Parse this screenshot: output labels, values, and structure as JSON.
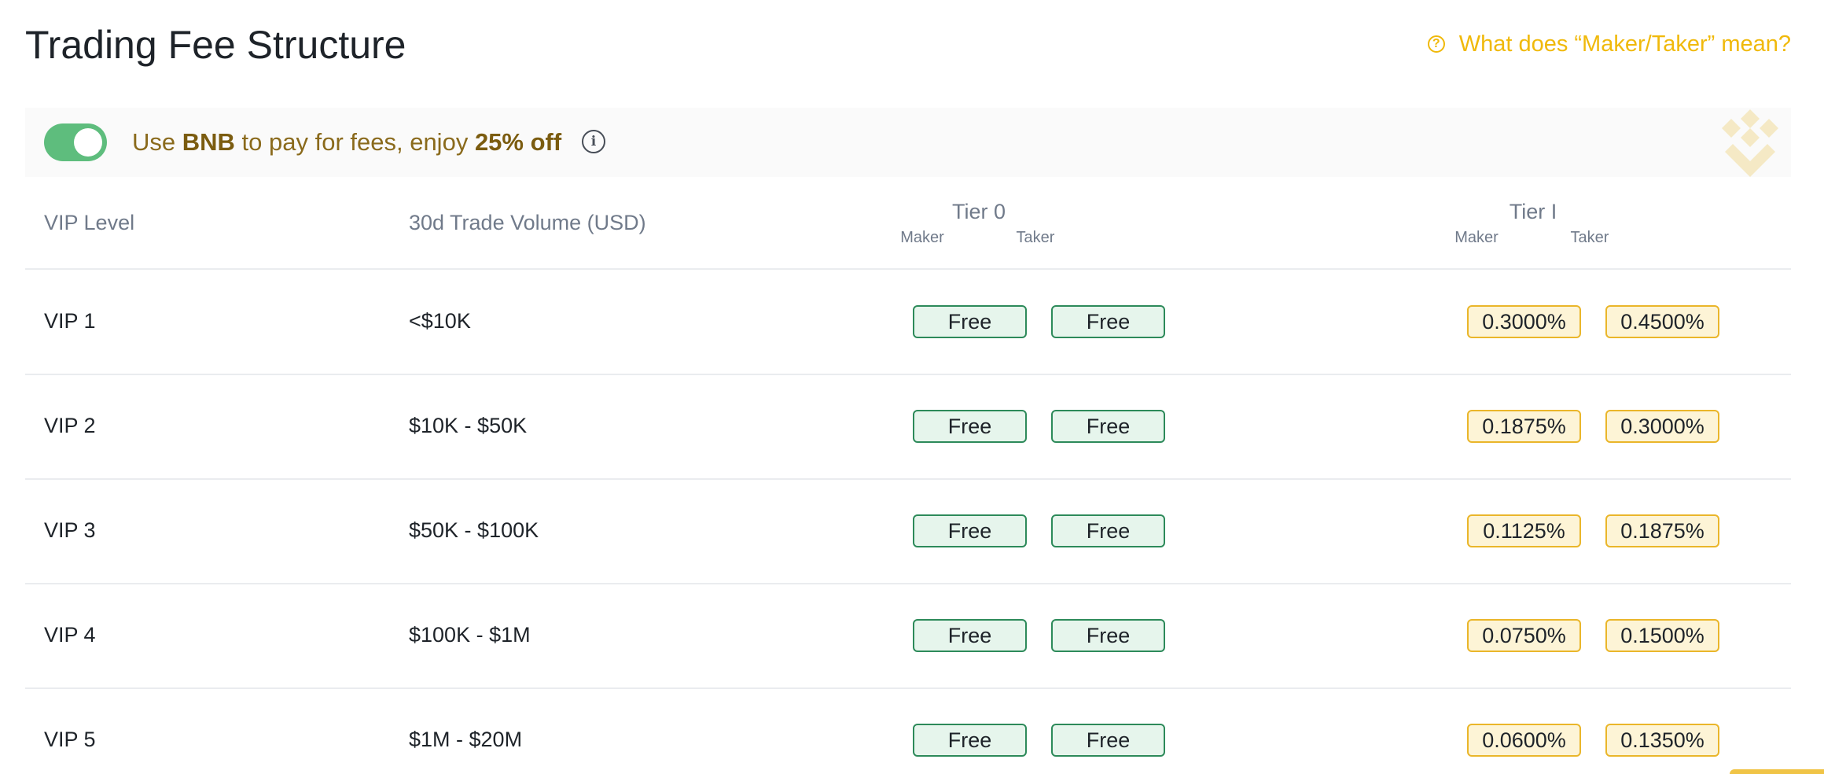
{
  "page": {
    "title": "Trading Fee Structure",
    "help_link": "What does “Maker/Taker” mean?"
  },
  "banner": {
    "text_before": "Use ",
    "text_bnb": "BNB",
    "text_middle": " to pay for fees, enjoy ",
    "text_discount": "25% off",
    "toggle_on": true
  },
  "table": {
    "col_vip": "VIP Level",
    "col_volume": "30d Trade Volume (USD)",
    "tiers": [
      {
        "name": "Tier 0",
        "maker": "Maker",
        "taker": "Taker"
      },
      {
        "name": "Tier I",
        "maker": "Maker",
        "taker": "Taker"
      }
    ],
    "rows": [
      {
        "vip": "VIP 1",
        "volume": "<$10K",
        "t0_maker": "Free",
        "t0_taker": "Free",
        "t1_maker": "0.3000%",
        "t1_taker": "0.4500%"
      },
      {
        "vip": "VIP 2",
        "volume": "$10K - $50K",
        "t0_maker": "Free",
        "t0_taker": "Free",
        "t1_maker": "0.1875%",
        "t1_taker": "0.3000%"
      },
      {
        "vip": "VIP 3",
        "volume": "$50K - $100K",
        "t0_maker": "Free",
        "t0_taker": "Free",
        "t1_maker": "0.1125%",
        "t1_taker": "0.1875%"
      },
      {
        "vip": "VIP 4",
        "volume": "$100K - $1M",
        "t0_maker": "Free",
        "t0_taker": "Free",
        "t1_maker": "0.0750%",
        "t1_taker": "0.1500%"
      },
      {
        "vip": "VIP 5",
        "volume": "$1M - $20M",
        "t0_maker": "Free",
        "t0_taker": "Free",
        "t1_maker": "0.0600%",
        "t1_taker": "0.1350%"
      }
    ]
  },
  "colors": {
    "accent": "#f0b90b",
    "toggle": "#5ebd7d",
    "free_bg": "#e6f5ec",
    "free_border": "#2d8a5a",
    "pct_bg": "#fdf4d6",
    "pct_border": "#eab62a"
  },
  "icons": {
    "help": "question-circle-icon",
    "info": "info-circle-icon",
    "brand": "bnb-logo-icon"
  }
}
